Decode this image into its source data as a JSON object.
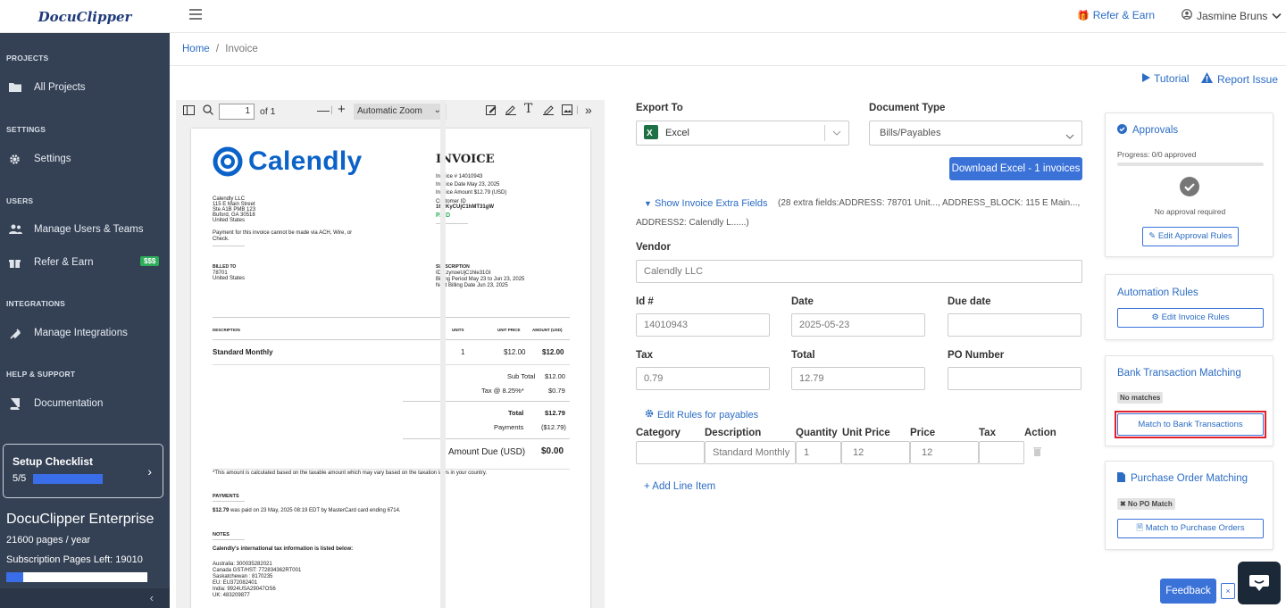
{
  "brand": {
    "logo": "DocuClipper"
  },
  "topbar": {
    "refer": "Refer & Earn",
    "user": "Jasmine Bruns"
  },
  "sidebar": {
    "sections": [
      "PROJECTS",
      "SETTINGS",
      "USERS",
      "INTEGRATIONS",
      "HELP & SUPPORT"
    ],
    "items": [
      {
        "label": "All Projects",
        "icon": "folder-icon"
      },
      {
        "label": "Settings",
        "icon": "gear-icon"
      },
      {
        "label": "Manage Users & Teams",
        "icon": "users-icon"
      },
      {
        "label": "Refer & Earn",
        "icon": "gift-icon",
        "badge": "$$$"
      },
      {
        "label": "Manage Integrations",
        "icon": "plug-icon"
      },
      {
        "label": "Documentation",
        "icon": "book-icon"
      }
    ],
    "setup": {
      "title": "Setup Checklist",
      "progress": "5/5"
    },
    "plan": "DocuClipper Enterprise",
    "pages_per_year": "21600 pages / year",
    "pages_left": "Subscription Pages Left: 19010",
    "pages_used_fraction": 0.12
  },
  "breadcrumb": {
    "home": "Home",
    "sep": "/",
    "current": "Invoice"
  },
  "actions": {
    "tutorial": "Tutorial",
    "report": "Report Issue"
  },
  "viewer": {
    "page_value": "1",
    "page_total": "of 1",
    "zoom": "Automatic Zoom",
    "doc": {
      "brand": "Calendly",
      "title": "INVOICE",
      "invoice_no": "Invoice #  14010943",
      "invoice_date": "Invoice Date  May 23, 2025",
      "invoice_amount": "Invoice Amount  $12.79 (USD)",
      "customer_id_label": "Customer ID",
      "customer_id": "16CKyCUjC1hMT31gW",
      "paid": "PAID",
      "from": [
        "Calendly LLC",
        "115 E Main Street",
        "Ste A1B PMB 123",
        "Buford, GA 30518",
        "United States"
      ],
      "note": "Payment for this invoice cannot be made via ACH, Wire, or",
      "note2": "Check.",
      "billed_label": "BILLED TO",
      "billed": [
        "78701",
        "United States"
      ],
      "sub_label": "SUBSCRIPTION",
      "sub_id": "ID  AzynoeUjC1hle31GI",
      "billing_period": "Billing Period  May 23 to Jun 23, 2025",
      "next_billing": "Next Billing Date  Jun 23, 2025",
      "cols": [
        "DESCRIPTION",
        "UNITS",
        "UNIT PRICE",
        "AMOUNT (USD)"
      ],
      "row": [
        "Standard Monthly",
        "1",
        "$12.00",
        "$12.00"
      ],
      "subtotal_label": "Sub Total",
      "subtotal": "$12.00",
      "tax_label": "Tax @ 8.25%*",
      "tax": "$0.79",
      "total_label": "Total",
      "total": "$12.79",
      "payments_label": "Payments",
      "payments": "($12.79)",
      "due_label": "Amount Due (USD)",
      "due": "$0.00",
      "footnote": "*This amount is calculated based on the taxable amount which may vary based on the taxation laws in your country.",
      "payments_head": "PAYMENTS",
      "payment_amt": "$12.79",
      "payment_line": "was paid on 23 May, 2025 08:19 EDT by MasterCard card ending 6714.",
      "notes_head": "NOTES",
      "notes_line": "Calendly's international tax information is listed below:",
      "tax_ids": [
        "Australia: 300035282021",
        "Canada GST/HST: 772834362RT001",
        "Saskatchewan : 8170235",
        "EU: EU372082401",
        "India: 9924USA29047OS6",
        "UK: 483209877"
      ]
    }
  },
  "form": {
    "export_to_label": "Export To",
    "export_to": "Excel",
    "doc_type_label": "Document Type",
    "doc_type": "Bills/Payables",
    "download": "Download Excel - 1 invoices",
    "extra_link": "Show Invoice Extra Fields",
    "extra_text": "(28 extra fields:ADDRESS: 78701 Unit..., ADDRESS_BLOCK: 115 E Main...,",
    "extra_text2": "ADDRESS2: Calendly L......)",
    "vendor_label": "Vendor",
    "vendor": "Calendly LLC",
    "id_label": "Id #",
    "id": "14010943",
    "date_label": "Date",
    "date": "2025-05-23",
    "due_label": "Due date",
    "due": "",
    "tax_label": "Tax",
    "tax": "0.79",
    "total_label": "Total",
    "total": "12.79",
    "po_label": "PO Number",
    "po": "",
    "rules_link": "Edit Rules for payables",
    "line_cols": [
      "Category",
      "Description",
      "Quantity",
      "Unit Price",
      "Price",
      "Tax",
      "Action"
    ],
    "line": {
      "category": "",
      "description": "Standard Monthly",
      "quantity": "1",
      "unit_price": "12",
      "price": "12",
      "tax": ""
    },
    "add_line": "+ Add Line Item"
  },
  "panels": {
    "approvals": {
      "title": "Approvals",
      "progress": "Progress: 0/0 approved",
      "status": "No approval required",
      "button": "Edit Approval Rules"
    },
    "automation": {
      "title": "Automation Rules",
      "button": "Edit Invoice Rules"
    },
    "bank": {
      "title": "Bank Transaction Matching",
      "tag": "No matches",
      "button": "Match to Bank Transactions"
    },
    "po": {
      "title": "Purchase Order Matching",
      "tag": "✖ No PO Match",
      "button": "Match to Purchase Orders"
    }
  },
  "feedback": {
    "label": "Feedback",
    "close": "×"
  },
  "colors": {
    "sidebar": "#344155",
    "accent": "#3a72d8",
    "highlight": "#e0202a",
    "paid": "#2eae5a"
  }
}
